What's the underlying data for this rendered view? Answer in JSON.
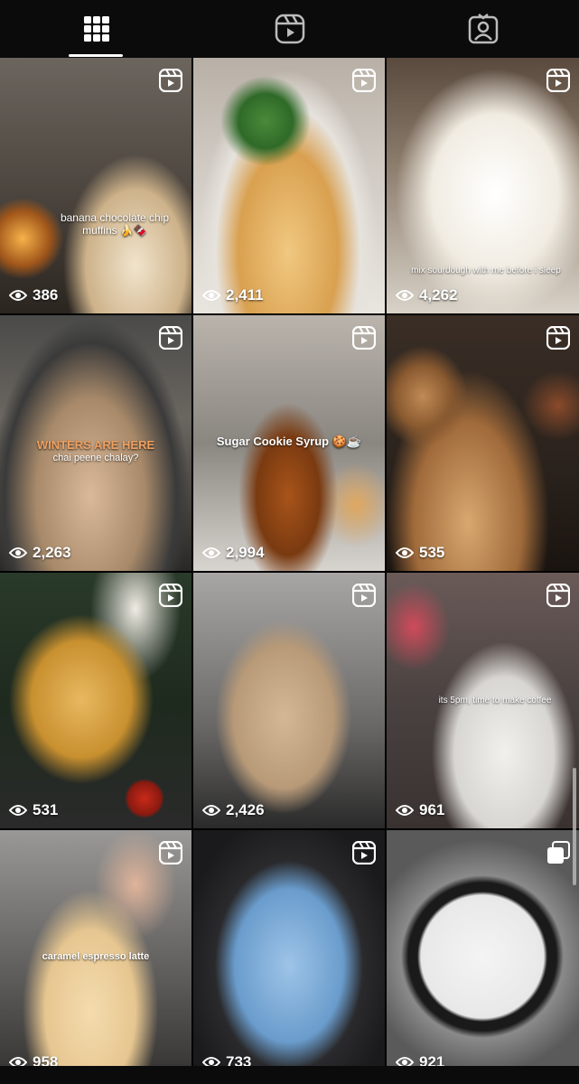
{
  "tabs": [
    {
      "icon": "grid-icon",
      "active": true
    },
    {
      "icon": "reels-icon",
      "active": false
    },
    {
      "icon": "tagged-icon",
      "active": false
    }
  ],
  "posts": [
    {
      "views": "386",
      "caption": "banana chocolate chip muffins 🍌🍫",
      "type": "reel"
    },
    {
      "views": "2,411",
      "caption": "",
      "type": "reel"
    },
    {
      "views": "4,262",
      "caption": "mix sourdough with me before i sleep",
      "type": "reel"
    },
    {
      "views": "2,263",
      "caption_title": "WINTERS ARE HERE",
      "caption": "chai peene chalay?",
      "type": "reel"
    },
    {
      "views": "2,994",
      "caption": "Sugar Cookie Syrup 🍪☕",
      "type": "reel"
    },
    {
      "views": "535",
      "caption": "",
      "type": "reel"
    },
    {
      "views": "531",
      "caption": "",
      "type": "reel"
    },
    {
      "views": "2,426",
      "caption": "",
      "type": "reel"
    },
    {
      "views": "961",
      "caption": "its 5pm, time to make coffee",
      "type": "reel"
    },
    {
      "views": "958",
      "caption": "caramel espresso latte",
      "type": "reel"
    },
    {
      "views": "733",
      "caption": "",
      "type": "reel"
    },
    {
      "views": "921",
      "caption": "",
      "type": "carousel"
    }
  ],
  "colors": {
    "background": "#000000",
    "tabbar": "#0b0b0b",
    "text": "#ffffff"
  }
}
